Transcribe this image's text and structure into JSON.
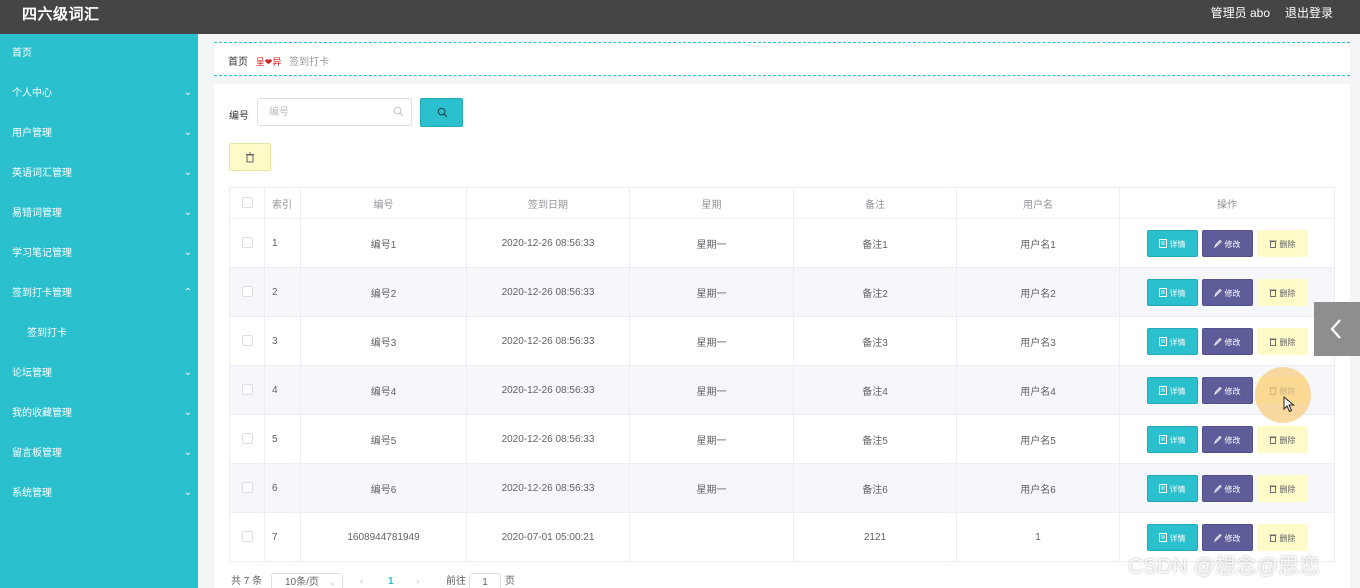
{
  "header": {
    "title": "四六级词汇",
    "user_label": "管理员 abo",
    "logout_label": "退出登录"
  },
  "sidebar": {
    "items": [
      {
        "label": "首页",
        "has_arrow": false
      },
      {
        "label": "个人中心",
        "has_arrow": true,
        "expanded": false
      },
      {
        "label": "用户管理",
        "has_arrow": true,
        "expanded": false
      },
      {
        "label": "英语词汇管理",
        "has_arrow": true,
        "expanded": false
      },
      {
        "label": "易错词管理",
        "has_arrow": true,
        "expanded": false
      },
      {
        "label": "学习笔记管理",
        "has_arrow": true,
        "expanded": false
      },
      {
        "label": "签到打卡管理",
        "has_arrow": true,
        "expanded": true
      },
      {
        "label": "签到打卡",
        "has_arrow": false,
        "sub": true
      },
      {
        "label": "论坛管理",
        "has_arrow": true,
        "expanded": false
      },
      {
        "label": "我的收藏管理",
        "has_arrow": true,
        "expanded": false
      },
      {
        "label": "留言板管理",
        "has_arrow": true,
        "expanded": false
      },
      {
        "label": "系统管理",
        "has_arrow": true,
        "expanded": false
      }
    ]
  },
  "breadcrumb": {
    "home": "首页",
    "separator": "呈❤异",
    "current": "签到打卡"
  },
  "search": {
    "label": "编号",
    "placeholder": "编号",
    "value": ""
  },
  "table": {
    "columns": [
      "",
      "索引",
      "编号",
      "签到日期",
      "星期",
      "备注",
      "用户名",
      "操作"
    ],
    "rows": [
      {
        "index": "1",
        "code": "编号1",
        "date": "2020-12-26 08:56:33",
        "weekday": "星期一",
        "remark": "备注1",
        "username": "用户名1"
      },
      {
        "index": "2",
        "code": "编号2",
        "date": "2020-12-26 08:56:33",
        "weekday": "星期一",
        "remark": "备注2",
        "username": "用户名2"
      },
      {
        "index": "3",
        "code": "编号3",
        "date": "2020-12-26 08:56:33",
        "weekday": "星期一",
        "remark": "备注3",
        "username": "用户名3"
      },
      {
        "index": "4",
        "code": "编号4",
        "date": "2020-12-26 08:56:33",
        "weekday": "星期一",
        "remark": "备注4",
        "username": "用户名4"
      },
      {
        "index": "5",
        "code": "编号5",
        "date": "2020-12-26 08:56:33",
        "weekday": "星期一",
        "remark": "备注5",
        "username": "用户名5"
      },
      {
        "index": "6",
        "code": "编号6",
        "date": "2020-12-26 08:56:33",
        "weekday": "星期一",
        "remark": "备注6",
        "username": "用户名6"
      },
      {
        "index": "7",
        "code": "1608944781949",
        "date": "2020-07-01 05:00:21",
        "weekday": "",
        "remark": "2121",
        "username": "1"
      }
    ],
    "actions": {
      "detail": "详情",
      "edit": "修改",
      "delete": "删除"
    }
  },
  "pagination": {
    "total_text": "共 7 条",
    "page_size": "10条/页",
    "current_page": "1",
    "goto_label": "前往",
    "goto_value": "1",
    "page_unit": "页"
  },
  "watermark": "CSDN @想念@思恋",
  "colors": {
    "sidebar": "#2bc0cd",
    "topbar": "#454545",
    "detail_button": "#2bc0cd",
    "edit_button": "#5e5d9a",
    "delete_button": "#fffbc8"
  }
}
